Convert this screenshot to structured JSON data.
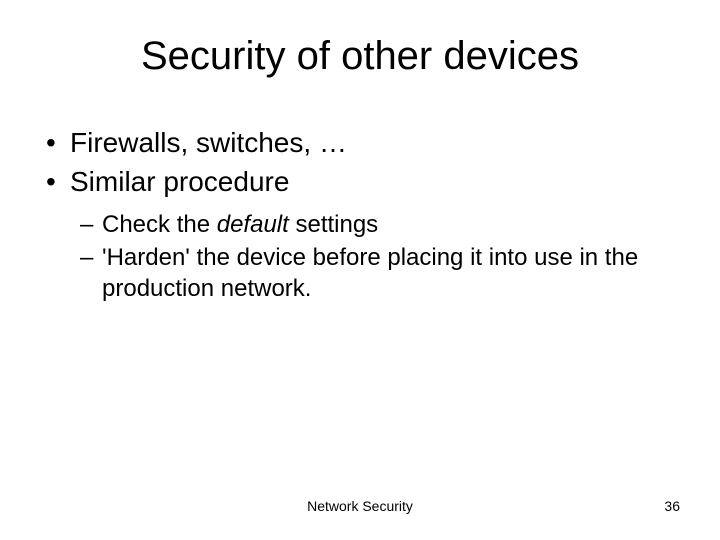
{
  "title": "Security of other devices",
  "bullets": {
    "b1": "Firewalls, switches, …",
    "b2": "Similar procedure",
    "sub1_pre": "Check the ",
    "sub1_em": "default",
    "sub1_post": " settings",
    "sub2": "'Harden' the device before placing it into use in the production network."
  },
  "footer": {
    "center": "Network Security",
    "page": "36"
  }
}
